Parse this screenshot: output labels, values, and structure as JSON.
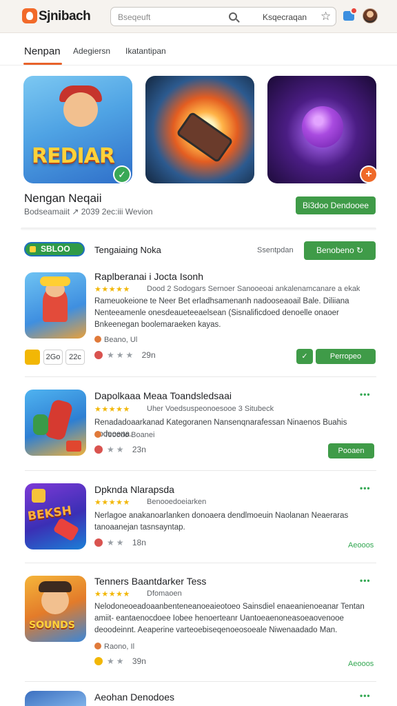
{
  "header": {
    "brand": "Sjnibach",
    "search_placeholder": "Bseqeuft",
    "search_label": "Ksqecraqan"
  },
  "tabs": [
    {
      "label": "Nenpan"
    },
    {
      "label": "Adegiersn"
    },
    {
      "label": "Ikatantipan"
    }
  ],
  "featured": {
    "cards": [
      {
        "art_text": "REDIAR"
      },
      {
        "art_text": ""
      },
      {
        "art_text": ""
      }
    ],
    "title": "Nengan Neqaii",
    "subtitle": "Bodseamaiit ↗ 2039 2ec:iii Wevion",
    "button": "Bi3doo Dendooee"
  },
  "section": {
    "tag": "SBLOO",
    "title": "Tengaiaing Noka",
    "link": "Ssentpdan",
    "button": "Benobeno ↻"
  },
  "items": [
    {
      "title": "Raplberanai i Jocta Isonh",
      "stars": "★★★★★",
      "meta": "Dood 2 Sodogars Sernoer Sanooeoai ankalenamcanare a ekak",
      "desc": "Rameuokeione te Neer Bet erladhsamenanh nadooseaoail Bale. Diliiana Nenteeamenle onesdeaueteeaelsean (Sisnalificdoed denoelle onaoer Bnkeenegan boolemaraeken kayas.",
      "developer": "Beano, Ul",
      "rating_count": "29n",
      "chips": [
        "2Go",
        "22c"
      ],
      "button": "Perropeo"
    },
    {
      "title": "Dapolkaaa Meaa Toandsledsaai",
      "stars": "★★★★★",
      "meta": "Uher Voedsuspeonoesooe 3 Situbeck",
      "desc": "Renadadoaarkanad Kategoranen Nansenqnarafessan Ninaenos Buahis aodooena.",
      "developer": "Teoodo Boanei",
      "rating_count": "23n",
      "button": "Pooaen"
    },
    {
      "title": "Dpknda Nlarapsda",
      "stars": "★★★★★",
      "meta": "Benooedoeiarken",
      "desc": "Nerlagoe anakanoarlanken donoaera dendlmoeuin Naolanan Neaeraras tanoaanejan tasnsayntap.",
      "developer": "",
      "rating_count": "18n",
      "button": "Aeooos"
    },
    {
      "title": "Tenners Baantdarker Tess",
      "stars": "★★★★★",
      "meta": "Dfomaoen",
      "desc": "Nelodoneoeadoaanbenteneanoeaieotoeo Sainsdiel enaeanienoeanar Tentan amiit- eantaenocdoee Iobee henoerteanr Uantoeaenoneasoeaovenooe deoodeinnt. Aeaperine varteoebiseqenoeosoeale Niwenaadado Man.",
      "developer": "Raono, Il",
      "rating_count": "39n",
      "button": "Aeooos"
    },
    {
      "title": "Aeohan Denodoes",
      "stars": "",
      "meta": "",
      "desc": "",
      "developer": "",
      "rating_count": "",
      "button": ""
    }
  ],
  "more_glyph": "•••",
  "colors": {
    "accent": "#e8622a",
    "green": "#3f9b48",
    "star": "#f2b705"
  }
}
